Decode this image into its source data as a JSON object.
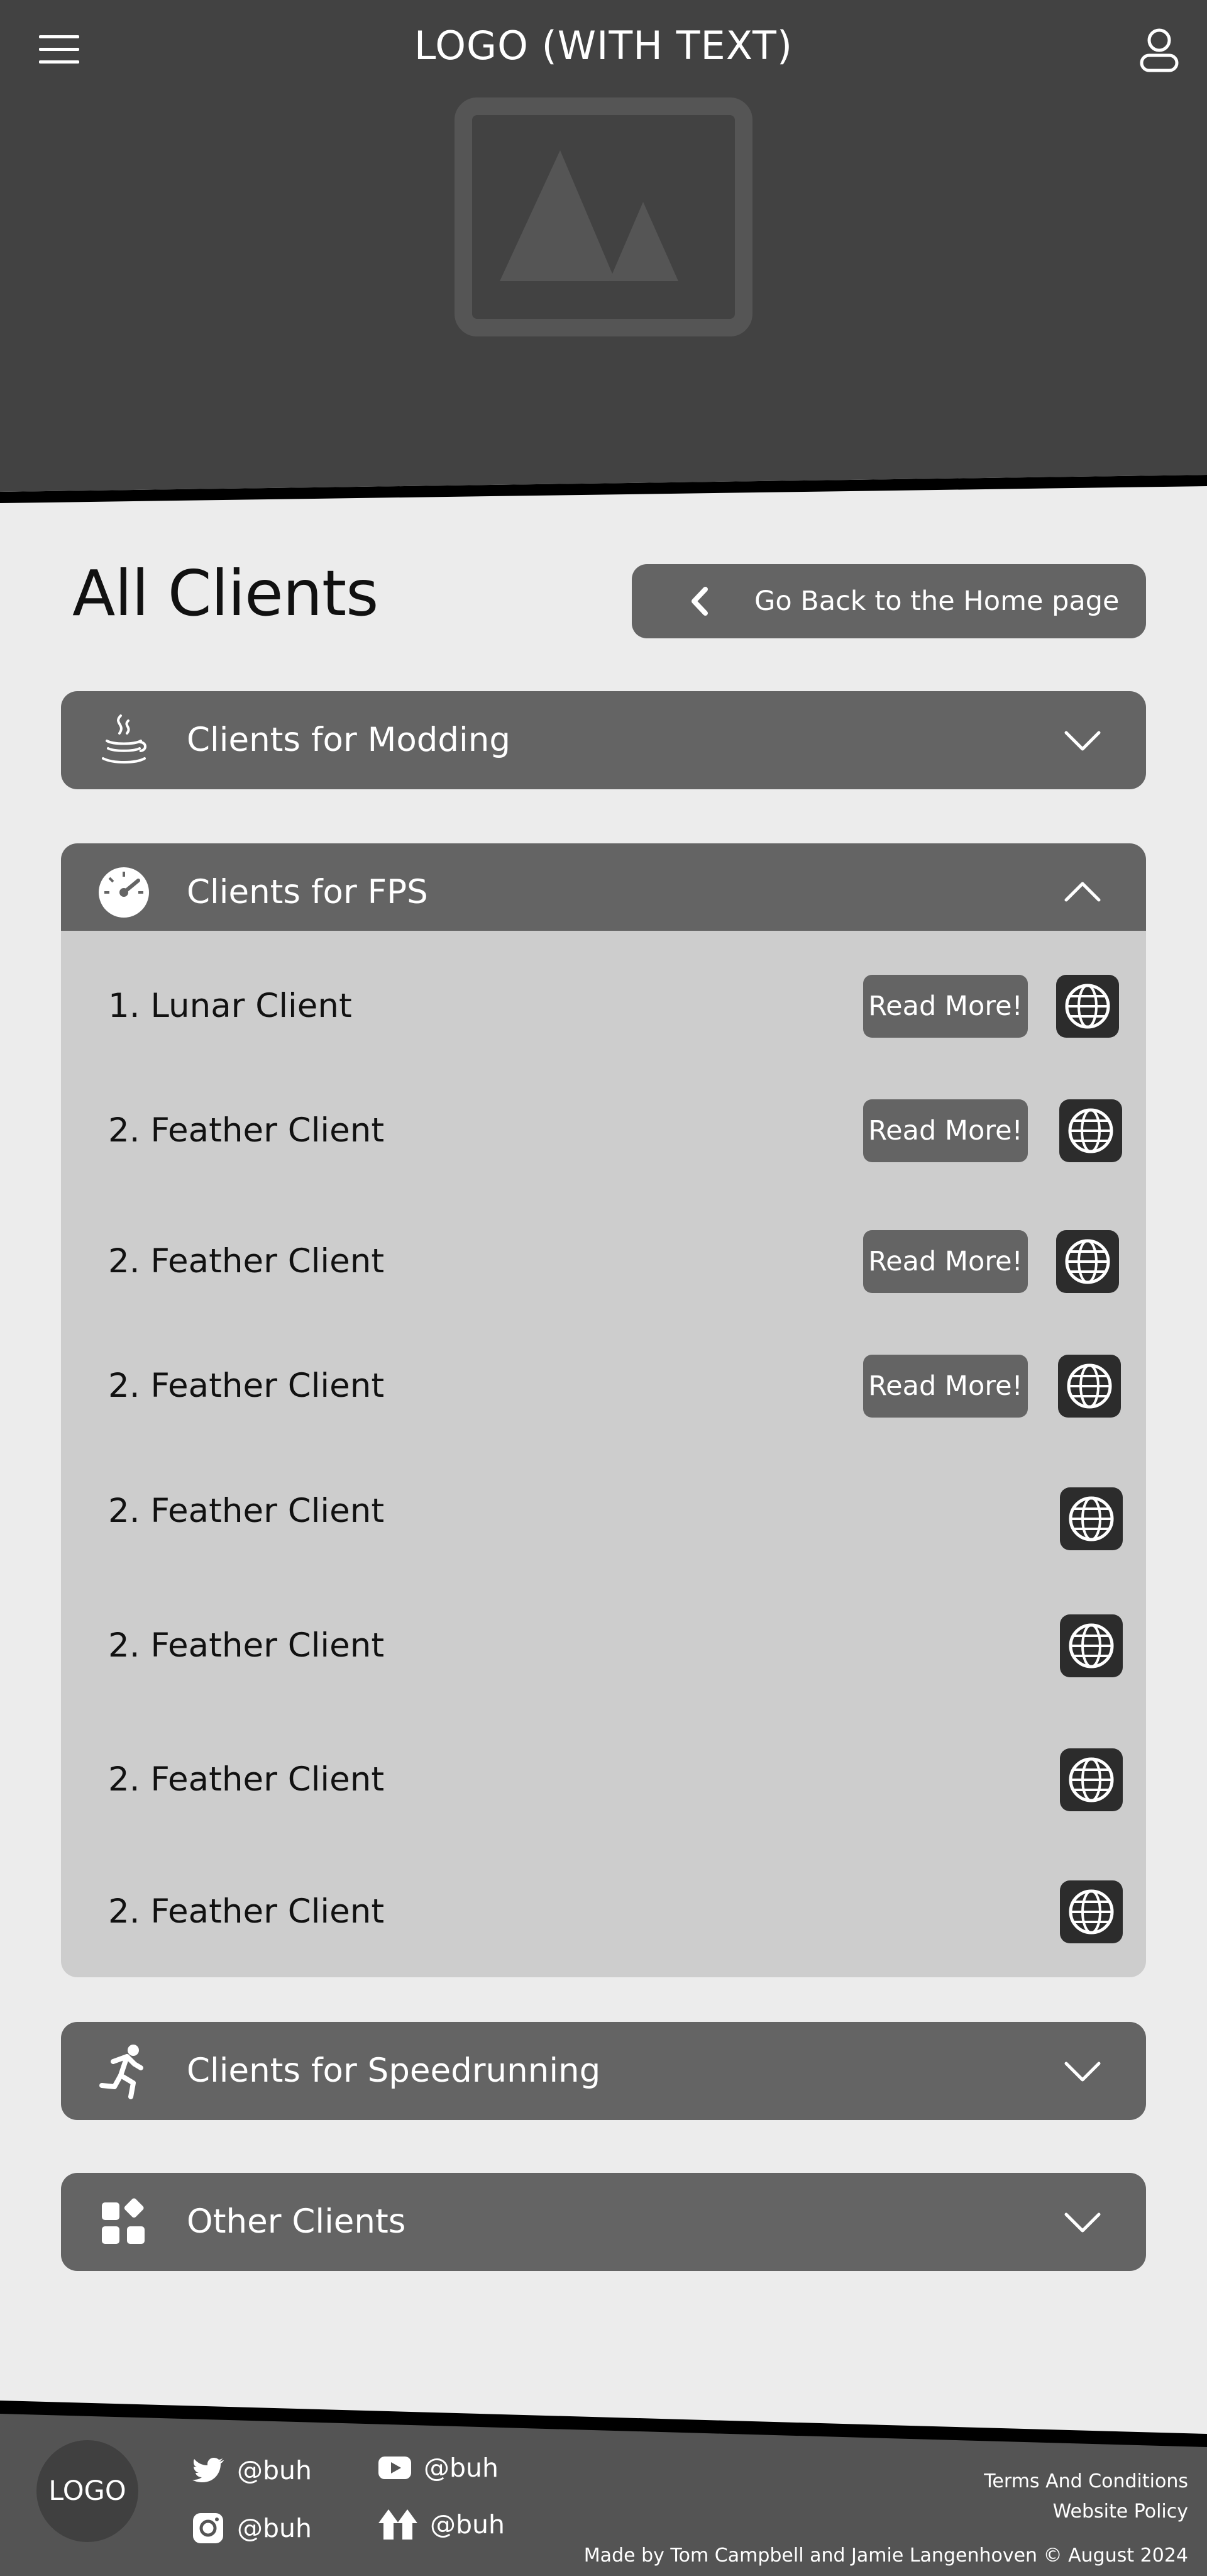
{
  "header": {
    "logo_text": "LOGO (WITH TEXT)",
    "menu_icon": "hamburger-menu-icon",
    "user_icon": "user-account-icon",
    "hero_icon": "image-placeholder-icon"
  },
  "page": {
    "title": "All Clients",
    "back_button_label": "Go Back to the Home page"
  },
  "accordions": [
    {
      "label": "Clients for Modding",
      "icon": "java-coffee-icon",
      "expanded": false
    },
    {
      "label": "Clients for FPS",
      "icon": "speedometer-icon",
      "expanded": true
    },
    {
      "label": "Clients for Speedrunning",
      "icon": "running-person-icon",
      "expanded": false
    },
    {
      "label": "Other Clients",
      "icon": "widgets-icon",
      "expanded": false
    }
  ],
  "fps_clients": [
    {
      "name": "1. Lunar Client",
      "read_more": "Read More!"
    },
    {
      "name": "2. Feather Client",
      "read_more": "Read More!"
    },
    {
      "name": "2. Feather Client",
      "read_more": "Read More!"
    },
    {
      "name": "2. Feather Client",
      "read_more": "Read More!"
    },
    {
      "name": "2. Feather Client",
      "read_more": ""
    },
    {
      "name": "2. Feather Client",
      "read_more": ""
    },
    {
      "name": "2. Feather Client",
      "read_more": ""
    },
    {
      "name": "2. Feather Client",
      "read_more": ""
    }
  ],
  "footer": {
    "logo_text": "LOGO",
    "socials": [
      {
        "network": "twitter",
        "icon": "twitter-icon",
        "handle": "@buh"
      },
      {
        "network": "youtube",
        "icon": "youtube-icon",
        "handle": "@buh"
      },
      {
        "network": "instagram",
        "icon": "instagram-icon",
        "handle": "@buh"
      },
      {
        "network": "linktree",
        "icon": "linktree-icon",
        "handle": "@buh"
      }
    ],
    "terms_link": "Terms And Conditions",
    "policy_link": "Website Policy",
    "credit": "Made by Tom Campbell and Jamie Langenhoven © August 2024"
  },
  "colors": {
    "header_bg": "#424242",
    "page_bg": "#ececec",
    "accordion_bg": "#646464",
    "panel_bg": "#cdcdcd",
    "globe_button_bg": "#2c2c2c",
    "footer_bg": "#545454"
  }
}
